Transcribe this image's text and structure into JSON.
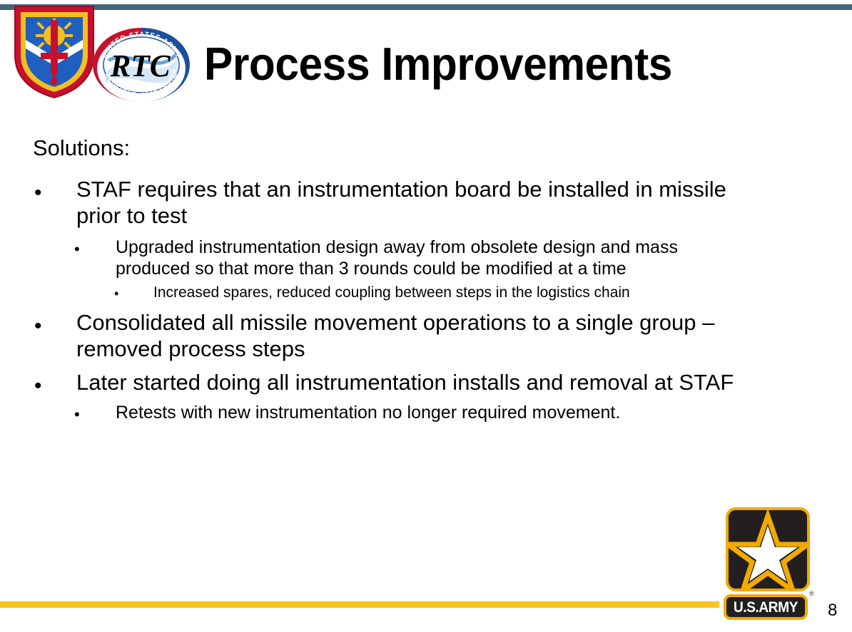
{
  "slide": {
    "title": "Process Improvements",
    "page_number": "8",
    "accent_top_bar_color": "#41657d",
    "accent_bottom_bar_color": "#f9c424",
    "background_color": "#ffffff",
    "text_color": "#000000"
  },
  "logos": {
    "shield": {
      "name": "army-test-evaluation-shield-emblem",
      "border_color": "#c8102e",
      "inner_border_color": "#f4c01f",
      "field_color": "#1f5fc0",
      "sun_color": "#f4c01f",
      "sword_color": "#c8102e",
      "band_color": "#ffffff"
    },
    "rtc": {
      "name": "redstone-test-center-roundel",
      "center_text": "RTC",
      "top_arc_text": "UNITED STATES ARMY",
      "bottom_left_arc_text": "REDSTONE",
      "bottom_right_arc_text": "TEST CENTER",
      "red_color": "#c8102e",
      "blue_color": "#1c4f9c",
      "swoosh_color": "#5b9bd5"
    },
    "army": {
      "name": "us-army-star-logo",
      "wordmark": "U.S.ARMY",
      "registered_mark": "®",
      "box_color": "#231f20",
      "gold_color": "#f2a900",
      "star_fill": "#ffffff"
    }
  },
  "content": {
    "lead_label": "Solutions:",
    "bullets": [
      {
        "level": 1,
        "marker": "•",
        "text": "STAF requires that an instrumentation board be installed in missile prior to test"
      },
      {
        "level": 2,
        "marker": "•",
        "text": "Upgraded instrumentation design away from obsolete design and mass produced so that more than 3 rounds could be modified at a time"
      },
      {
        "level": 3,
        "marker": "•",
        "text": "Increased spares, reduced coupling between steps in the logistics chain"
      },
      {
        "level": 1,
        "marker": "•",
        "text": "Consolidated all missile movement operations to a single group – removed process steps"
      },
      {
        "level": 1,
        "marker": "•",
        "text": "Later started doing all instrumentation installs and removal at STAF"
      },
      {
        "level": 2,
        "marker": "•",
        "text": "Retests with new instrumentation no longer required movement."
      }
    ]
  }
}
